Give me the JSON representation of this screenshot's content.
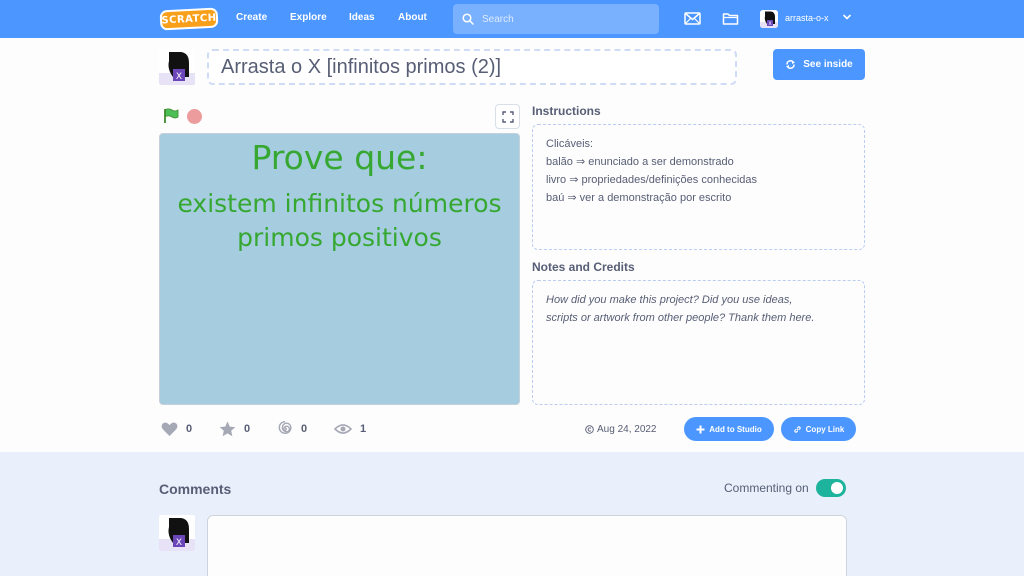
{
  "nav": {
    "logo_text": "SCRATCH",
    "links": [
      "Create",
      "Explore",
      "Ideas",
      "About"
    ],
    "search_placeholder": "Search",
    "username": "arrasta-o-x"
  },
  "project": {
    "title": "Arrasta o X [infinitos primos (2)]",
    "see_inside_label": "See inside",
    "stage": {
      "title": "Prove que:",
      "body_line1": "existem infinitos números",
      "body_line2": "primos positivos"
    },
    "instructions_label": "Instructions",
    "instructions": [
      "Clicáveis:",
      "balão ⇒ enunciado a ser demonstrado",
      "livro ⇒ propriedades/definições conhecidas",
      "baú ⇒ ver a demonstração por escrito"
    ],
    "notes_label": "Notes and Credits",
    "notes_placeholder_line1": "How did you make this project? Did you use ideas,",
    "notes_placeholder_line2": "scripts or artwork from other people? Thank them here.",
    "stats": {
      "loves": "0",
      "favorites": "0",
      "remixes": "0",
      "views": "1"
    },
    "date": "Aug 24, 2022",
    "add_to_studio_label": "Add to Studio",
    "copy_link_label": "Copy Link"
  },
  "comments": {
    "title": "Comments",
    "commenting_label": "Commenting on",
    "commenting_enabled": true
  },
  "colors": {
    "nav_blue": "#4c97ff",
    "stage_text_green": "#36a832",
    "stage_bg": "#a5ccdf",
    "toggle_on": "#1eb39c"
  }
}
